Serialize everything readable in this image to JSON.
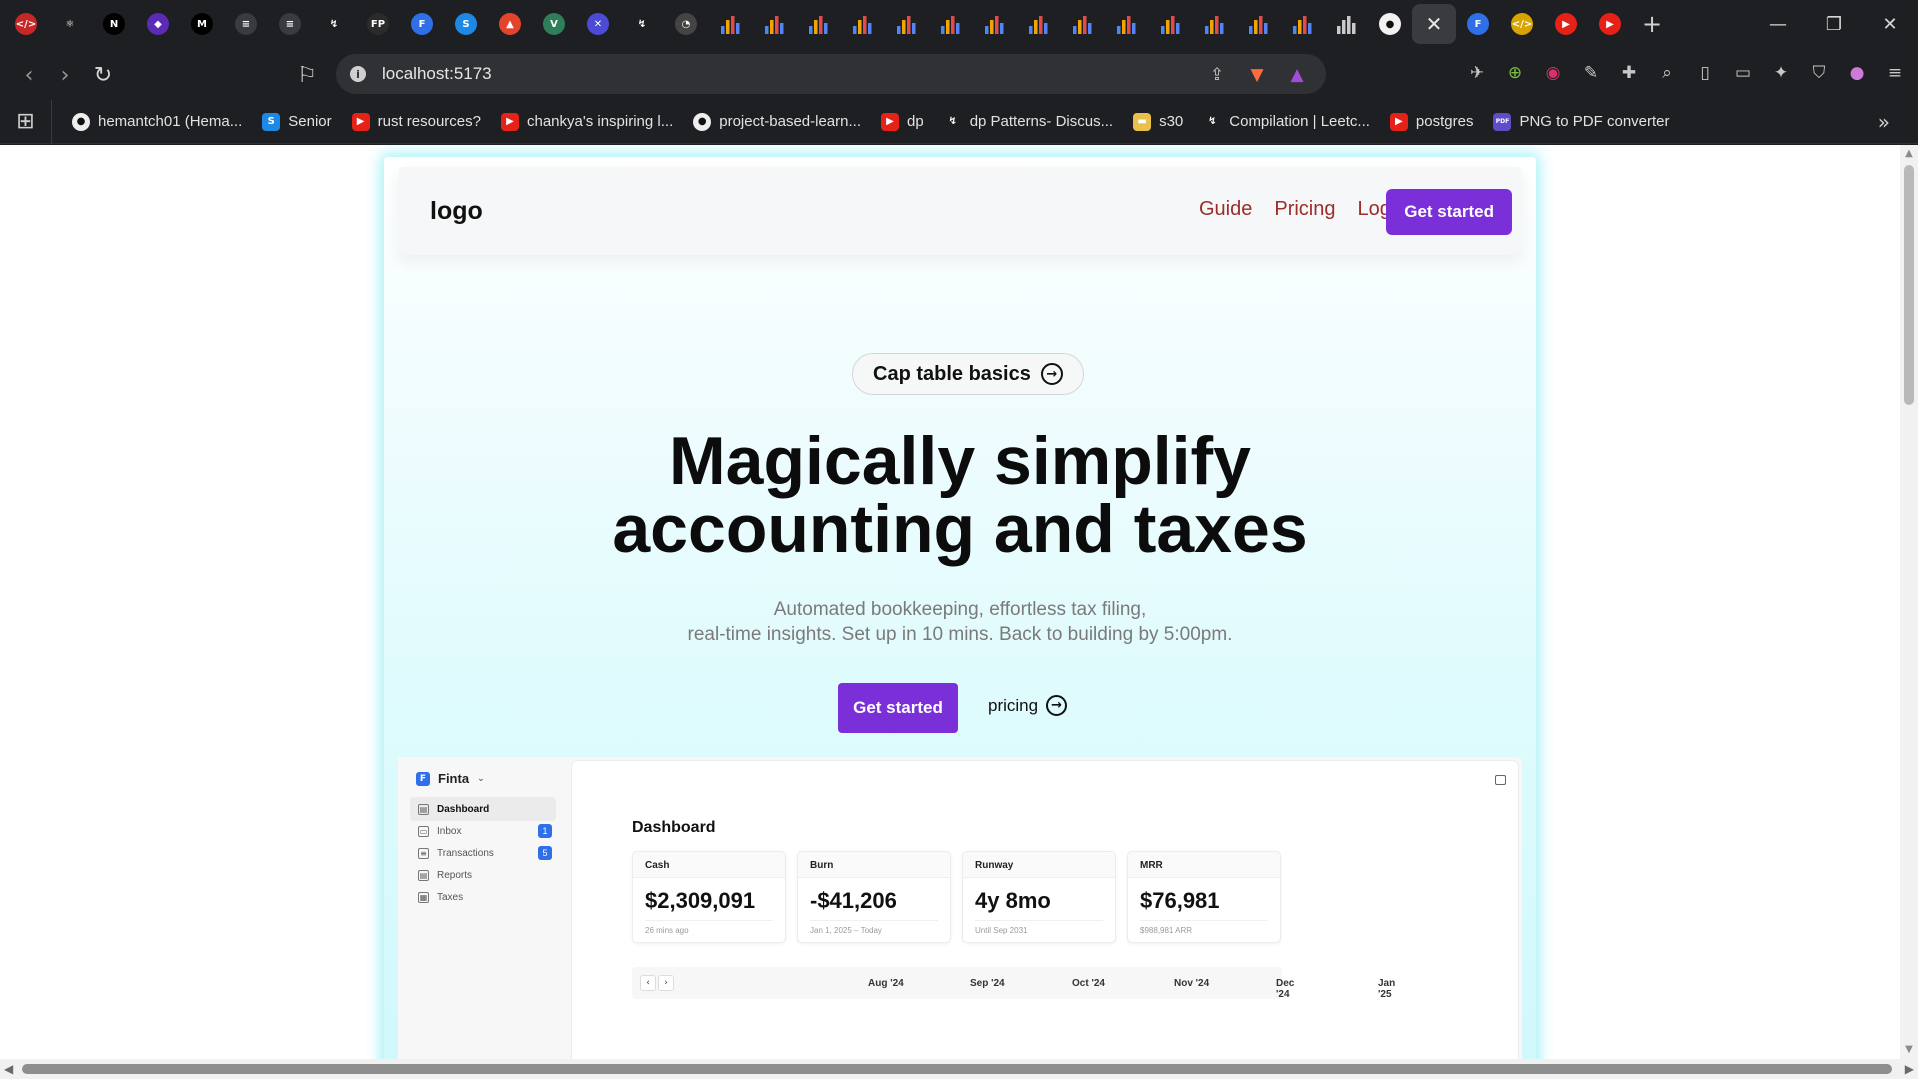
{
  "browser": {
    "tabs": [
      {
        "name": "code-tab",
        "glyph": "</>",
        "bg": "#c62828"
      },
      {
        "name": "react-tab",
        "glyph": "⚛",
        "bg": "#1e1f22"
      },
      {
        "name": "next-tab",
        "glyph": "N",
        "bg": "#000000"
      },
      {
        "name": "purple-tab",
        "glyph": "◆",
        "bg": "#5b2bb5"
      },
      {
        "name": "medium-tab",
        "glyph": "M",
        "bg": "#000000"
      },
      {
        "name": "dp-tab-1",
        "glyph": "≡",
        "bg": "#3a3b3f"
      },
      {
        "name": "dp-tab-2",
        "glyph": "≡",
        "bg": "#3a3b3f"
      },
      {
        "name": "lc-tab",
        "glyph": "↯",
        "bg": "#1e1f22"
      },
      {
        "name": "fp-tab",
        "glyph": "FP",
        "bg": "#2b2b2b"
      },
      {
        "name": "f-tab",
        "glyph": "F",
        "bg": "#2f6fe8"
      },
      {
        "name": "s-tab",
        "glyph": "S",
        "bg": "#1e88e5"
      },
      {
        "name": "brave-tab",
        "glyph": "▲",
        "bg": "#e2452c"
      },
      {
        "name": "vue-tab",
        "glyph": "V",
        "bg": "#2e7d5b"
      },
      {
        "name": "x-tab",
        "glyph": "✕",
        "bg": "#4b4bd6"
      },
      {
        "name": "lc-tab-2",
        "glyph": "↯",
        "bg": "#1e1f22"
      },
      {
        "name": "chart-tab",
        "glyph": "◔",
        "bg": "#444444"
      }
    ],
    "bar_tab_count": 15,
    "tail_tabs": [
      {
        "name": "github-tab",
        "glyph": "●",
        "bg": "#f2f2f2"
      },
      {
        "name": "active-tab-close",
        "glyph": "✕",
        "bg": "active"
      },
      {
        "name": "finta-tab",
        "glyph": "F",
        "bg": "#2f6fe8"
      },
      {
        "name": "yellow-tab",
        "glyph": "</>",
        "bg": "#d9a400"
      },
      {
        "name": "youtube-tab-1",
        "glyph": "▶",
        "bg": "#e62117"
      },
      {
        "name": "youtube-tab-2",
        "glyph": "▶",
        "bg": "#e62117"
      }
    ],
    "new_tab": "+",
    "window": {
      "minimize": "—",
      "restore": "❐",
      "close": "✕"
    },
    "nav": {
      "back": "‹",
      "forward": "›",
      "reload": "↻",
      "bookmark": "⚐"
    },
    "url": "localhost:5173",
    "bookmarks": [
      {
        "label": "hemantch01 (Hema...",
        "icon": "github-icon",
        "glyph": "●",
        "bg": "#eeeeee"
      },
      {
        "label": "Senior",
        "icon": "s-icon",
        "glyph": "S",
        "bg": "#1e88e5"
      },
      {
        "label": "rust resources?",
        "icon": "youtube-icon",
        "glyph": "▶",
        "bg": "#e62117"
      },
      {
        "label": "chankya's inspiring l...",
        "icon": "youtube-icon",
        "glyph": "▶",
        "bg": "#e62117"
      },
      {
        "label": "project-based-learn...",
        "icon": "github-icon",
        "glyph": "●",
        "bg": "#eeeeee"
      },
      {
        "label": "dp",
        "icon": "youtube-icon",
        "glyph": "▶",
        "bg": "#e62117"
      },
      {
        "label": "dp Patterns- Discus...",
        "icon": "leetcode-icon",
        "glyph": "↯",
        "bg": "#1e1f22"
      },
      {
        "label": "s30",
        "icon": "folder-icon",
        "glyph": "▬",
        "bg": "#e8c04a"
      },
      {
        "label": "Compilation | Leetc...",
        "icon": "leetcode-icon",
        "glyph": "↯",
        "bg": "#1e1f22"
      },
      {
        "label": "postgres",
        "icon": "youtube-icon",
        "glyph": "▶",
        "bg": "#e62117"
      },
      {
        "label": "PNG to PDF converter",
        "icon": "pdf24-icon",
        "glyph": "PDF",
        "bg": "#5c4ec9"
      }
    ]
  },
  "site": {
    "logo": "logo",
    "nav": {
      "guide": "Guide",
      "pricing": "Pricing",
      "login": "Log in",
      "get_started": "Get started"
    },
    "pill": "Cap table basics",
    "headline_line1": "Magically simplify",
    "headline_line2": "accounting and taxes",
    "sub_line1": "Automated bookkeeping, effortless tax filing,",
    "sub_line2": "real-time insights. Set up in 10 mins. Back to building by 5:00pm.",
    "cta_primary": "Get started",
    "cta_secondary": "pricing",
    "colors": {
      "accent": "#7a2fd8",
      "nav_link": "#9b2d2a",
      "glow": "#40e2f0"
    }
  },
  "dashboard": {
    "brand": "Finta",
    "sidebar": [
      {
        "label": "Dashboard",
        "icon": "▤",
        "badge": ""
      },
      {
        "label": "Inbox",
        "icon": "▭",
        "badge": "1"
      },
      {
        "label": "Transactions",
        "icon": "≡",
        "badge": "5"
      },
      {
        "label": "Reports",
        "icon": "▤",
        "badge": ""
      },
      {
        "label": "Taxes",
        "icon": "▦",
        "badge": ""
      }
    ],
    "title": "Dashboard",
    "cards": [
      {
        "label": "Cash",
        "value": "$2,309,091",
        "note": "26 mins ago"
      },
      {
        "label": "Burn",
        "value": "-$41,206",
        "note": "Jan 1, 2025 – Today"
      },
      {
        "label": "Runway",
        "value": "4y 8mo",
        "note": "Until Sep 2031"
      },
      {
        "label": "MRR",
        "value": "$76,981",
        "note": "$988,981 ARR"
      }
    ],
    "months": [
      "Aug '24",
      "Sep '24",
      "Oct '24",
      "Nov '24",
      "Dec '24",
      "Jan '25"
    ],
    "timeline_prev": "‹",
    "timeline_next": "›"
  }
}
